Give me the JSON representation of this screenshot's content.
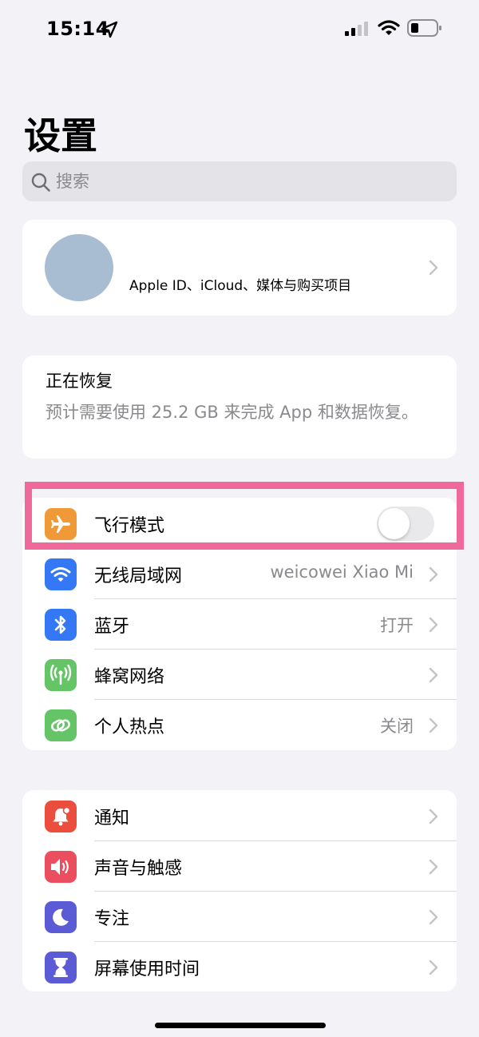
{
  "status_bar": {
    "time": "15:14",
    "icons": [
      "location-arrow-icon",
      "cellular-signal-icon",
      "wifi-icon",
      "battery-icon"
    ]
  },
  "page_title": "设置",
  "search": {
    "placeholder": "搜索",
    "value": ""
  },
  "profile": {
    "subtitle": "Apple ID、iCloud、媒体与购买项目"
  },
  "restore": {
    "title": "正在恢复",
    "description": "预计需要使用 25.2 GB 来完成 App 和数据恢复。"
  },
  "network_group": {
    "items": [
      {
        "label": "飞行模式",
        "icon": "airplane-icon",
        "color": "#f09a37",
        "toggle": false
      },
      {
        "label": "无线局域网",
        "icon": "wifi-icon",
        "color": "#3478f6",
        "value": "weicowei Xiao Mi"
      },
      {
        "label": "蓝牙",
        "icon": "bluetooth-icon",
        "color": "#3478f6",
        "value": "打开"
      },
      {
        "label": "蜂窝网络",
        "icon": "cellular-antenna-icon",
        "color": "#65c466",
        "value": ""
      },
      {
        "label": "个人热点",
        "icon": "hotspot-link-icon",
        "color": "#65c466",
        "value": "关闭"
      }
    ]
  },
  "notifications_group": {
    "items": [
      {
        "label": "通知",
        "icon": "bell-icon",
        "color": "#eb4e3d"
      },
      {
        "label": "声音与触感",
        "icon": "speaker-icon",
        "color": "#eb4e5e"
      },
      {
        "label": "专注",
        "icon": "moon-icon",
        "color": "#5b5bd6"
      },
      {
        "label": "屏幕使用时间",
        "icon": "hourglass-icon",
        "color": "#5b5bd6"
      }
    ]
  },
  "colors": {
    "background": "#f2f2f7",
    "highlight": "#ef6a9a",
    "secondary_text": "#8a8a8e"
  }
}
